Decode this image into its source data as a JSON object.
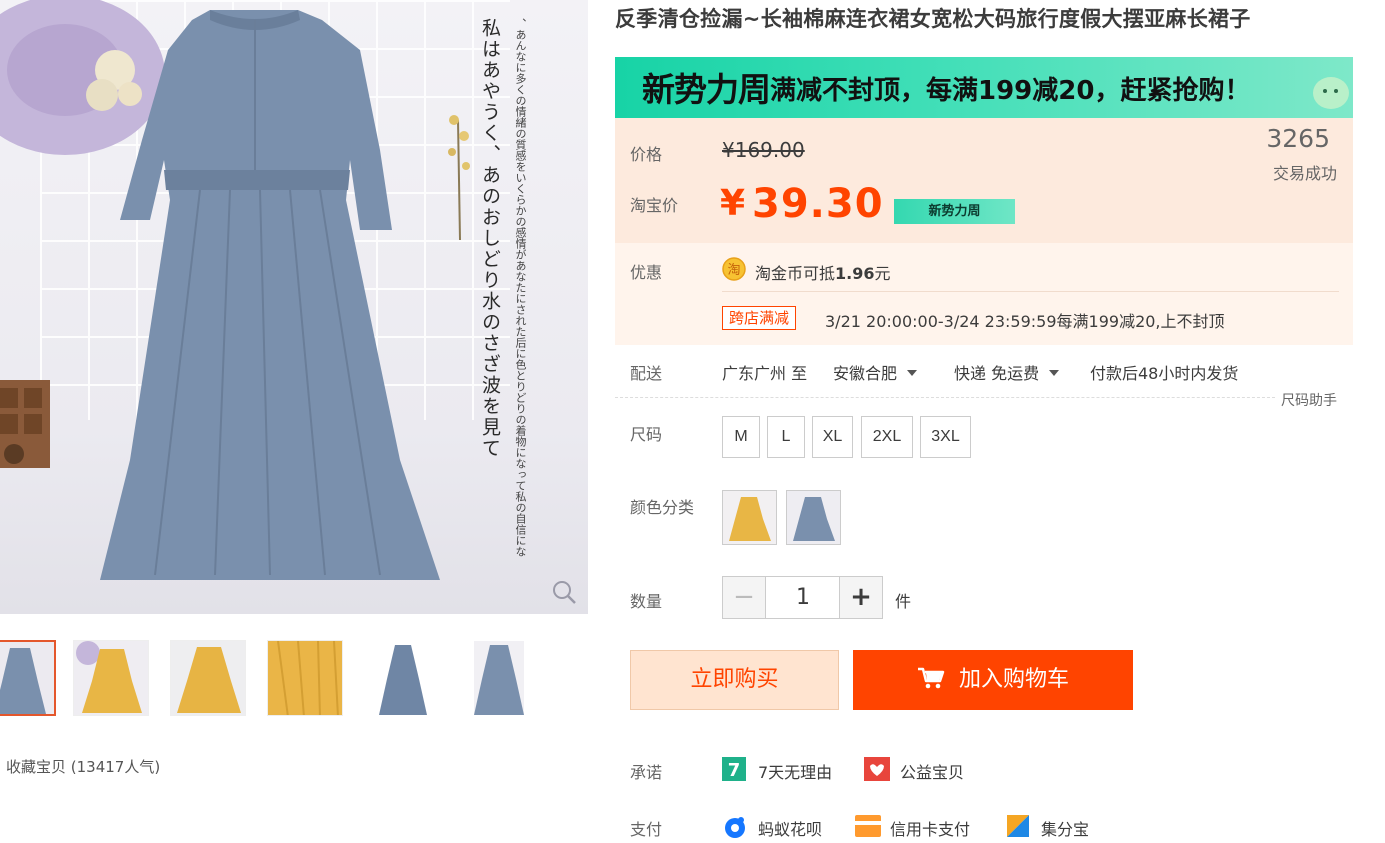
{
  "gallery": {
    "overlay_text_main": "私はあやうく、あのおしどり水のさざ波を見て",
    "overlay_text_sub": "、あんなに多くの情緒の質感をいくらかの感情があなたにされた后に色とりどりの着物になって私の自信にな",
    "thumbnails": [
      {
        "color": "blue",
        "active": true
      },
      {
        "color": "yellow",
        "active": false
      },
      {
        "color": "yellow",
        "active": false
      },
      {
        "color": "yellow",
        "active": false
      },
      {
        "color": "blue",
        "active": false
      },
      {
        "color": "blue",
        "active": false
      }
    ],
    "favorite_text": "收藏宝贝 (13417人气)"
  },
  "product": {
    "title": "反季清仓捡漏~长袖棉麻连衣裙女宽松大码旅行度假大摆亚麻长裙子"
  },
  "promo": {
    "logo": "新势力周",
    "text": "满减不封顶，每满199减20，赶紧抢购！",
    "colors": {
      "start": "#17d3a6",
      "end": "#7ee8c9"
    }
  },
  "price": {
    "label": "价格",
    "original": "¥169.00",
    "taobao_label": "淘宝价",
    "currency": "¥",
    "current": "39.30",
    "tag": "新势力周",
    "sold_count": "3265",
    "sold_label": "交易成功"
  },
  "discount": {
    "label": "优惠",
    "coin_text": "淘金币可抵",
    "coin_amount": "1.96",
    "coin_unit": "元",
    "tag": "跨店满减",
    "desc": "3/21 20:00:00-3/24 23:59:59每满199减20,上不封顶"
  },
  "delivery": {
    "label": "配送",
    "from": "广东广州 至",
    "to": "安徽合肥",
    "method": "快递 免运费",
    "note": "付款后48小时内发货"
  },
  "size": {
    "helper": "尺码助手",
    "label": "尺码",
    "options": [
      "M",
      "L",
      "XL",
      "2XL",
      "3XL"
    ]
  },
  "color": {
    "label": "颜色分类",
    "options": [
      {
        "color": "yellow"
      },
      {
        "color": "blue"
      }
    ]
  },
  "quantity": {
    "label": "数量",
    "value": "1",
    "minus": "−",
    "plus": "+",
    "unit": "件"
  },
  "actions": {
    "buy_now": "立即购买",
    "add_to_cart": "加入购物车",
    "accent": "#ff4400"
  },
  "promise": {
    "label": "承诺",
    "items": [
      {
        "icon": "seven-day-return-icon",
        "text": "7天无理由"
      },
      {
        "icon": "charity-icon",
        "text": "公益宝贝"
      }
    ]
  },
  "payment": {
    "label": "支付",
    "items": [
      {
        "icon": "huabei-icon",
        "text": "蚂蚁花呗"
      },
      {
        "icon": "credit-card-icon",
        "text": "信用卡支付"
      },
      {
        "icon": "jifenbao-icon",
        "text": "集分宝"
      }
    ]
  }
}
